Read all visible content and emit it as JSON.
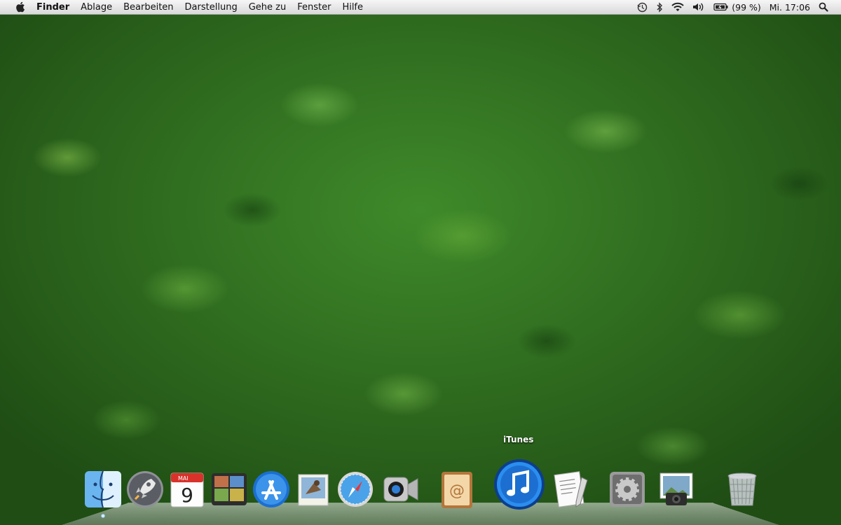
{
  "menubar": {
    "apple_icon": "apple-icon",
    "app_name": "Finder",
    "menus": [
      "Ablage",
      "Bearbeiten",
      "Darstellung",
      "Gehe zu",
      "Fenster",
      "Hilfe"
    ],
    "status": {
      "time_machine_icon": "time-machine-icon",
      "bluetooth_icon": "bluetooth-icon",
      "wifi_icon": "wifi-icon",
      "volume_icon": "volume-icon",
      "battery_icon": "battery-icon",
      "battery_text": "(99 %)",
      "clock": "Mi. 17:06",
      "spotlight_icon": "spotlight-search-icon"
    }
  },
  "dock": {
    "hover_label": "iTunes",
    "icons": [
      {
        "name": "finder-icon",
        "running": true
      },
      {
        "name": "launchpad-icon",
        "running": false
      },
      {
        "name": "calendar-icon",
        "month": "MAI",
        "day": "9",
        "running": false
      },
      {
        "name": "photo-booth-icon",
        "running": false
      },
      {
        "name": "app-store-icon",
        "running": false
      },
      {
        "name": "mail-icon",
        "running": false
      },
      {
        "name": "safari-icon",
        "running": false
      },
      {
        "name": "facetime-icon",
        "running": false
      },
      {
        "name": "address-book-icon",
        "running": false
      },
      {
        "name": "itunes-icon",
        "running": false
      },
      {
        "name": "textedit-preview-icon",
        "running": false
      },
      {
        "name": "system-preferences-icon",
        "running": false
      },
      {
        "name": "iphoto-icon",
        "running": false
      },
      {
        "name": "trash-icon",
        "running": false
      }
    ]
  },
  "colors": {
    "menubar_top": "#f6f6f6",
    "menubar_bottom": "#d9d9d9",
    "wallpaper_green": "#3f8a2a"
  }
}
